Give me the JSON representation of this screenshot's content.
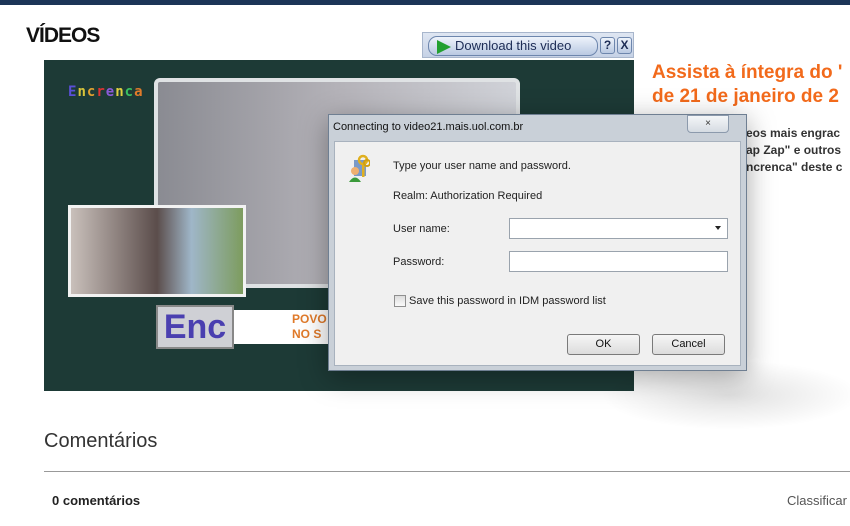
{
  "page": {
    "section_title": "VÍDEOS",
    "headline_lines": [
      "Assista à íntegra do '",
      "de 21 de janeiro de 2"
    ],
    "description_lines": [
      "eos mais engrac",
      "ap Zap\" e outros",
      "ncrenca\" deste c"
    ],
    "comments_title": "Comentários",
    "comments_count": "0 comentários",
    "sort_label": "Classificar",
    "accent_color": "#f26a1b",
    "topbar_color": "#1c3557"
  },
  "video": {
    "show_logo": "Encrenca",
    "badge": "Enc",
    "strip_lines": [
      "POVO",
      "NO S"
    ]
  },
  "idm_bar": {
    "download_label": "Download this video",
    "help_label": "?",
    "close_label": "X"
  },
  "dialog": {
    "title": "Connecting to video21.mais.uol.com.br",
    "close_label": "×",
    "prompt": "Type your user name and password.",
    "realm": "Realm: Authorization Required",
    "username_label": "User name:",
    "username_value": "",
    "password_label": "Password:",
    "password_value": "",
    "save_password_label": "Save this password in IDM password list",
    "save_password_checked": false,
    "ok_label": "OK",
    "cancel_label": "Cancel"
  }
}
